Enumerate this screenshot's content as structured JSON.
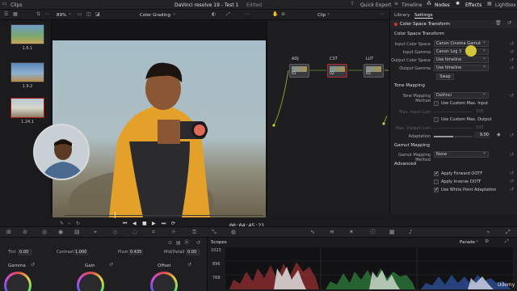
{
  "topbar": {
    "clips_tab": "Clips",
    "project_title": "DaVinci resolve 19 - Test 1",
    "edited_badge": "Edited",
    "quick_export": "Quick Export",
    "timeline": "Timeline",
    "nodes": "Nodes",
    "effects": "Effects",
    "lightbox": "Lightbox"
  },
  "viewerbar": {
    "zoom": "89%",
    "mode": "Color Grading",
    "clip_dropdown": "Clip"
  },
  "clips": [
    {
      "number": "1.6.1"
    },
    {
      "number": "1.9.2"
    },
    {
      "number": "1.24.1"
    }
  ],
  "viewer": {
    "timecode": "00:04:45:21"
  },
  "nodes": [
    {
      "label": "ADJ",
      "num": "01"
    },
    {
      "label": "CST",
      "num": "02"
    },
    {
      "label": "LUT",
      "num": "03"
    }
  ],
  "settings": {
    "tab_library": "Library",
    "tab_settings": "Settings",
    "header": "Color Space Transform",
    "section_cst": "Color Space Transform",
    "input_color_space_label": "Input Color Space",
    "input_color_space_value": "Canon Cinema Gamut",
    "input_gamma_label": "Input Gamma",
    "input_gamma_value": "Canon Log 3",
    "output_color_space_label": "Output Color Space",
    "output_color_space_value": "Use timeline",
    "output_gamma_label": "Output Gamma",
    "output_gamma_value": "Use timeline",
    "swap": "Swap",
    "section_tone": "Tone Mapping",
    "tone_method_label": "Tone Mapping Method",
    "tone_method_value": "DaVinci",
    "custom_max_input": "Use Custom Max. Input",
    "max_input_label": "Max. Input Lum",
    "max_input_value": "100",
    "custom_max_output": "Use Custom Max. Output",
    "max_output_label": "Max. Output Lum",
    "max_output_value": "100",
    "adaptation_label": "Adaptation",
    "adaptation_value": "9.00",
    "adaptation_fraction": 0.5,
    "section_gamut": "Gamut Mapping",
    "gamut_method_label": "Gamut Mapping Method",
    "gamut_method_value": "None",
    "section_advanced": "Advanced",
    "forward_ootf": "Apply Forward OOTF",
    "inverse_ootf": "Apply Inverse OOTF",
    "white_point": "Use White Point Adaptation",
    "forward_ootf_checked": true,
    "inverse_ootf_checked": false,
    "white_point_checked": true
  },
  "bottom": {
    "tint_label": "Tint",
    "tint_value": "0.00",
    "contrast_label": "Contrast",
    "contrast_value": "1.000",
    "pivot_label": "Pivot",
    "pivot_value": "0.435",
    "middetail_label": "Mid/Detail",
    "middetail_value": "0.00",
    "gamma": "Gamma",
    "gain": "Gain",
    "offset": "Offset",
    "scopes": "Scopes",
    "parade": "Parade",
    "scope_top": "1023",
    "scope_mid": "896",
    "scope_low": "768"
  },
  "watermark": "Udemy"
}
